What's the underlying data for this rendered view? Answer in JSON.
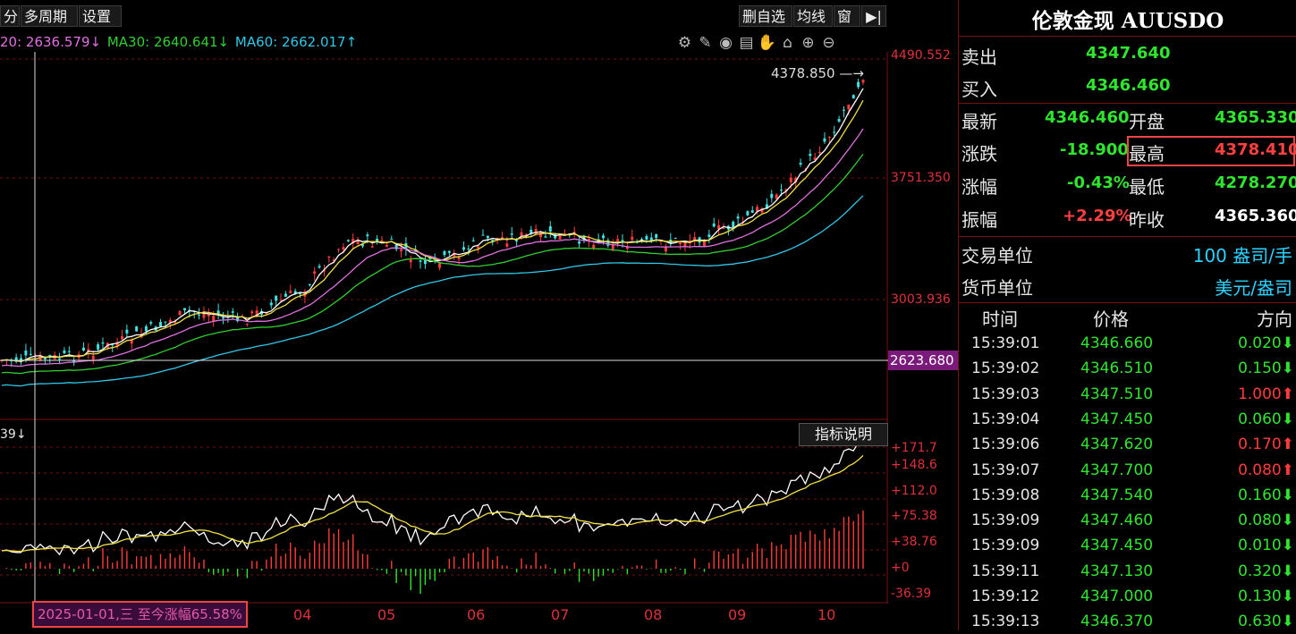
{
  "toolbar": {
    "left_buttons": [
      "分",
      "多周期",
      "设置"
    ],
    "right_buttons": [
      "删自选",
      "均线",
      "窗"
    ],
    "collapse_icon": "panel-collapse-icon"
  },
  "ma": {
    "ma20": "20: 2636.579↓",
    "ma30": "MA30: 2640.641↓",
    "ma60": "MA60: 2662.017↑"
  },
  "chart_icons": [
    "settings-icon",
    "pen-icon",
    "eye-icon",
    "calculator-icon",
    "hand-icon",
    "lock-icon",
    "zoom-in-icon",
    "zoom-out-icon"
  ],
  "axis": {
    "price_labels": [
      "4490.552",
      "3751.350",
      "3003.936"
    ],
    "hover_price": "2623.680",
    "indicator_top_label": "39↓",
    "indicator_labels": [
      "+171.7",
      "+148.6",
      "+112.0",
      "+75.38",
      "+38.76",
      "+0",
      "-36.39"
    ],
    "months": [
      "04",
      "05",
      "06",
      "07",
      "08",
      "09",
      "10"
    ]
  },
  "peak_label": "4378.850",
  "hover_info": "2025-01-01,三 至今涨幅65.58%",
  "indicator_button": "指标说明",
  "panel": {
    "title": "伦敦金现 AUUSDO",
    "sell_label": "卖出",
    "sell": "4347.640",
    "buy_label": "买入",
    "buy": "4346.460",
    "latest_label": "最新",
    "latest": "4346.460",
    "open_label": "开盘",
    "open": "4365.330",
    "change_label": "涨跌",
    "change": "-18.900",
    "high_label": "最高",
    "high": "4378.410",
    "pct_label": "涨幅",
    "pct": "-0.43%",
    "low_label": "最低",
    "low": "4278.270",
    "amp_label": "振幅",
    "amp": "+2.29%",
    "prev_label": "昨收",
    "prev": "4365.360",
    "unit_label": "交易单位",
    "unit": "100 盎司/手",
    "currency_label": "货币单位",
    "currency": "美元/盎司",
    "col_time": "时间",
    "col_price": "价格",
    "col_dir": "方向"
  },
  "trades": [
    {
      "time": "15:39:01",
      "price": "4346.660",
      "dir": "0.020",
      "up": false
    },
    {
      "time": "15:39:02",
      "price": "4346.510",
      "dir": "0.150",
      "up": false
    },
    {
      "time": "15:39:03",
      "price": "4347.510",
      "dir": "1.000",
      "up": true
    },
    {
      "time": "15:39:04",
      "price": "4347.450",
      "dir": "0.060",
      "up": false
    },
    {
      "time": "15:39:06",
      "price": "4347.620",
      "dir": "0.170",
      "up": true
    },
    {
      "time": "15:39:07",
      "price": "4347.700",
      "dir": "0.080",
      "up": true
    },
    {
      "time": "15:39:08",
      "price": "4347.540",
      "dir": "0.160",
      "up": false
    },
    {
      "time": "15:39:09",
      "price": "4347.460",
      "dir": "0.080",
      "up": false
    },
    {
      "time": "15:39:09",
      "price": "4347.450",
      "dir": "0.010",
      "up": false
    },
    {
      "time": "15:39:11",
      "price": "4347.130",
      "dir": "0.320",
      "up": false
    },
    {
      "time": "15:39:12",
      "price": "4347.000",
      "dir": "0.130",
      "up": false
    },
    {
      "time": "15:39:13",
      "price": "4346.370",
      "dir": "0.630",
      "up": false
    }
  ],
  "colors": {
    "up": "#ff3b3b",
    "down": "#2fe62f",
    "ma5": "#ffffff",
    "ma10": "#f0e040",
    "ma20": "#e070e0",
    "ma30": "#30d030",
    "ma60": "#30c8e8",
    "grid": "#7a1010"
  }
}
